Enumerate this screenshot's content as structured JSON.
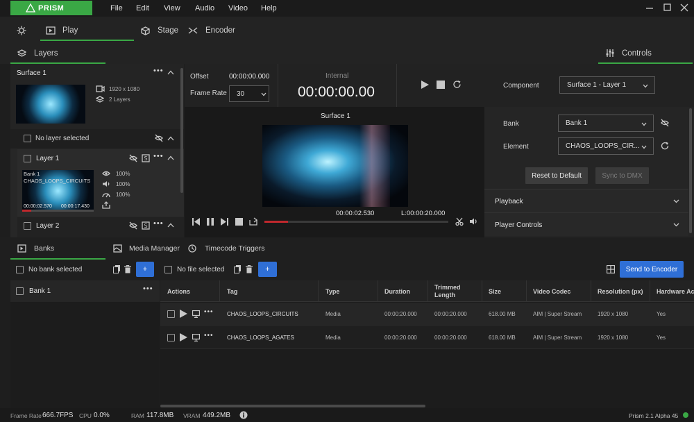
{
  "app": {
    "name": "PRISM",
    "version": "Prism 2.1 Alpha 45"
  },
  "menu": [
    "File",
    "Edit",
    "View",
    "Audio",
    "Video",
    "Help"
  ],
  "tabs": {
    "play": "Play",
    "stage": "Stage",
    "encoder": "Encoder"
  },
  "layers_tab": "Layers",
  "controls_tab": "Controls",
  "surface": {
    "name": "Surface 1",
    "resolution": "1920 x 1080",
    "layers": "2 Layers"
  },
  "no_layer": "No layer selected",
  "layer1": {
    "name": "Layer 1",
    "bank": "Bank 1",
    "element": "CHAOS_LOOPS_CIRCUITS",
    "opacity": "100%",
    "volume": "100%",
    "speed": "100%",
    "time_pos": "00:00:02.570",
    "time_len": "00:00:17.430",
    "progress": 0.13
  },
  "layer2": {
    "name": "Layer 2"
  },
  "timing": {
    "offset_label": "Offset",
    "offset": "00:00:00.000",
    "framerate_label": "Frame Rate",
    "framerate": "30",
    "mode": "Internal",
    "clock": "00:00:00.00"
  },
  "preview": {
    "label": "Surface 1",
    "position": "00:00:02.530",
    "length": "L:00:00:20.000",
    "progress": 0.13
  },
  "controls": {
    "component_label": "Component",
    "component": "Surface 1 - Layer 1",
    "bank_label": "Bank",
    "bank": "Bank 1",
    "element_label": "Element",
    "element": "CHAOS_LOOPS_CIR...",
    "reset": "Reset to Default",
    "sync": "Sync to DMX",
    "playback": "Playback",
    "player_controls": "Player Controls"
  },
  "bottom_tabs": {
    "banks": "Banks",
    "media": "Media Manager",
    "timecode": "Timecode Triggers"
  },
  "banks_bar": {
    "no_bank": "No bank selected",
    "no_file": "No file selected",
    "plus": "+",
    "send": "Send to Encoder"
  },
  "banks": [
    {
      "name": "Bank 1"
    }
  ],
  "table": {
    "headers": [
      "Actions",
      "Tag",
      "Type",
      "Duration",
      "Trimmed Length",
      "Size",
      "Video Codec",
      "Resolution (px)",
      "Hardware Acc"
    ],
    "rows": [
      [
        "CHAOS_LOOPS_CIRCUITS",
        "Media",
        "00:00:20.000",
        "00:00:20.000",
        "618.00 MB",
        "AIM | Super Stream",
        "1920 x 1080",
        "Yes"
      ],
      [
        "CHAOS_LOOPS_AGATES",
        "Media",
        "00:00:20.000",
        "00:00:20.000",
        "618.00 MB",
        "AIM | Super Stream",
        "1920 x 1080",
        "Yes"
      ]
    ]
  },
  "status": {
    "framerate_label": "Frame Rate",
    "framerate": "666.7FPS",
    "cpu_label": "CPU",
    "cpu": "0.0%",
    "ram_label": "RAM",
    "ram": "117.8MB",
    "vram_label": "VRAM",
    "vram": "449.2MB"
  },
  "colors": {
    "accent": "#3aa845",
    "blue": "#2f6fd6",
    "progress": "#c0282d"
  }
}
